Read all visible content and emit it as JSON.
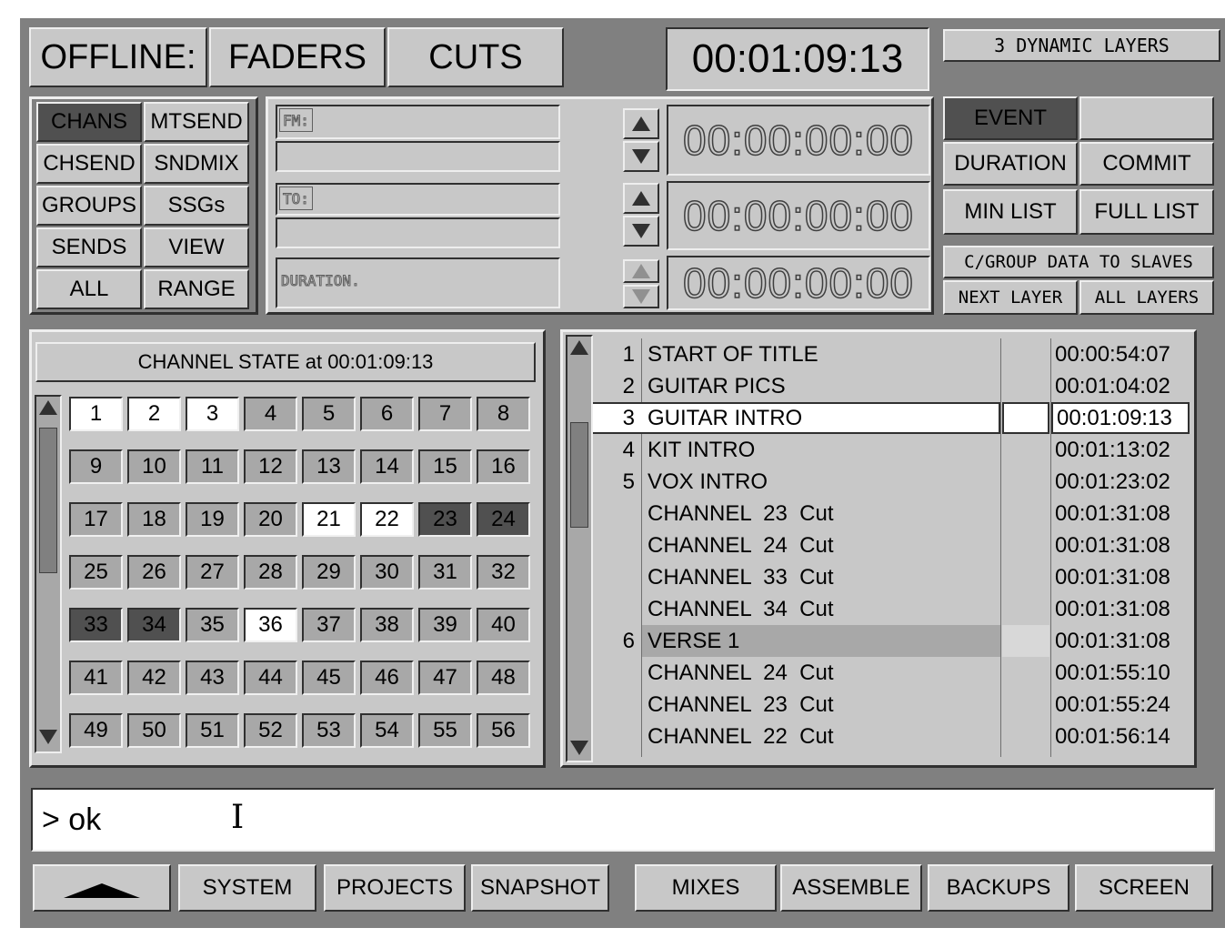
{
  "header": {
    "mode_label": "OFFLINE:",
    "faders_label": "FADERS",
    "cuts_label": "CUTS",
    "timecode": "00:01:09:13",
    "layers_label": "3 DYNAMIC LAYERS"
  },
  "category_buttons": [
    {
      "label": "CHANS",
      "active": true
    },
    {
      "label": "MTSEND",
      "active": false
    },
    {
      "label": "CHSEND",
      "active": false
    },
    {
      "label": "SNDMIX",
      "active": false
    },
    {
      "label": "GROUPS",
      "active": false
    },
    {
      "label": "SSGs",
      "active": false
    },
    {
      "label": "SENDS",
      "active": false
    },
    {
      "label": "VIEW",
      "active": false
    },
    {
      "label": "ALL",
      "active": false
    },
    {
      "label": "RANGE",
      "active": false
    }
  ],
  "range": {
    "from_label": "FM:",
    "to_label": "TO:",
    "duration_label": "DURATION.",
    "from_tc": "00:00:00:00",
    "to_tc": "00:00:00:00",
    "duration_tc": "00:00:00:00"
  },
  "event_buttons": {
    "event": "EVENT",
    "duration": "DURATION",
    "commit": "COMMIT",
    "min_list": "MIN LIST",
    "full_list": "FULL LIST",
    "cgroup": "C/GROUP DATA TO SLAVES",
    "next_layer": "NEXT LAYER",
    "all_layers": "ALL LAYERS"
  },
  "channel_state": {
    "title": "CHANNEL STATE at 00:01:09:13",
    "channels": [
      "1",
      "2",
      "3",
      "4",
      "5",
      "6",
      "7",
      "8",
      "9",
      "10",
      "11",
      "12",
      "13",
      "14",
      "15",
      "16",
      "17",
      "18",
      "19",
      "20",
      "21",
      "22",
      "23",
      "24",
      "25",
      "26",
      "27",
      "28",
      "29",
      "30",
      "31",
      "32",
      "33",
      "34",
      "35",
      "36",
      "37",
      "38",
      "39",
      "40",
      "41",
      "42",
      "43",
      "44",
      "45",
      "46",
      "47",
      "48",
      "49",
      "50",
      "51",
      "52",
      "53",
      "54",
      "55",
      "56"
    ],
    "on": [
      "1",
      "2",
      "3",
      "21",
      "22",
      "36"
    ],
    "cut": [
      "23",
      "24",
      "33",
      "34"
    ]
  },
  "event_list": [
    {
      "num": "1",
      "name": "START OF TITLE",
      "time": "00:00:54:07"
    },
    {
      "num": "2",
      "name": "GUITAR PICS",
      "time": "00:01:04:02"
    },
    {
      "num": "3",
      "name": "GUITAR INTRO",
      "time": "00:01:09:13",
      "selected": true
    },
    {
      "num": "4",
      "name": "KIT INTRO",
      "time": "00:01:13:02"
    },
    {
      "num": "5",
      "name": "VOX INTRO",
      "time": "00:01:23:02"
    },
    {
      "num": "",
      "name": "CHANNEL  23  Cut",
      "time": "00:01:31:08"
    },
    {
      "num": "",
      "name": "CHANNEL  24  Cut",
      "time": "00:01:31:08"
    },
    {
      "num": "",
      "name": "CHANNEL  33  Cut",
      "time": "00:01:31:08"
    },
    {
      "num": "",
      "name": "CHANNEL  34  Cut",
      "time": "00:01:31:08"
    },
    {
      "num": "6",
      "name": "VERSE 1",
      "time": "00:01:31:08",
      "highlight": true
    },
    {
      "num": "",
      "name": "CHANNEL  24  Cut",
      "time": "00:01:55:10"
    },
    {
      "num": "",
      "name": "CHANNEL  23  Cut",
      "time": "00:01:55:24"
    },
    {
      "num": "",
      "name": "CHANNEL  22  Cut",
      "time": "00:01:56:14"
    }
  ],
  "command_line": {
    "text": "> ok"
  },
  "footer": [
    {
      "label": "SYSTEM"
    },
    {
      "label": "PROJECTS"
    },
    {
      "label": "SNAPSHOT"
    },
    {
      "label": "MIXES"
    },
    {
      "label": "ASSEMBLE"
    },
    {
      "label": "BACKUPS"
    },
    {
      "label": "SCREEN"
    }
  ],
  "colors": {
    "background": "#808080",
    "panel": "#c8c8c8",
    "active": "#505050",
    "channel_on": "#ffffff",
    "channel_off": "#a8a8a8"
  }
}
